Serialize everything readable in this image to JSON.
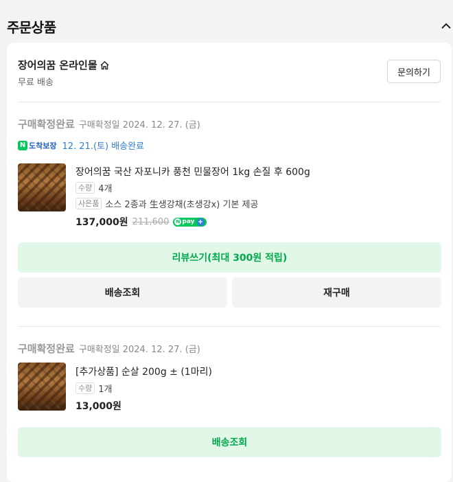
{
  "section": {
    "title": "주문상품",
    "collapse_icon": "chevron-up-icon"
  },
  "store": {
    "name": "장어의꿈 온라인몰",
    "home_icon": "home-icon",
    "shipping": "무료 배송",
    "inquiry_label": "문의하기"
  },
  "orders": [
    {
      "status": "구매확정완료",
      "confirm_date": "구매확정일 2024. 12. 27. (금)",
      "guarantee_badge": "도착보장",
      "delivery": "12. 21.(토) 배송완료",
      "product_name": "장어의꿈 국산 자포니카 풍천 민물장어 1kg 손질 후 600g",
      "qty_label": "수량",
      "qty": "4개",
      "gift_label": "사은품",
      "gift": "소스 2종과 生생강채(초생강x) 기본 제공",
      "price": "137,000원",
      "original_price": "211,600",
      "npay": "pay",
      "review_label": "리뷰쓰기(최대 300원 적립)",
      "track_label": "배송조회",
      "reorder_label": "재구매"
    },
    {
      "status": "구매확정완료",
      "confirm_date": "구매확정일 2024. 12. 27. (금)",
      "product_name": "[추가상품] 순살 200g ± (1마리)",
      "qty_label": "수량",
      "qty": "1개",
      "price": "13,000원",
      "track_label": "배송조회"
    }
  ],
  "colors": {
    "accent_green": "#03c75a",
    "accent_green_text": "#03a94d",
    "link_blue": "#2f7cd6"
  }
}
